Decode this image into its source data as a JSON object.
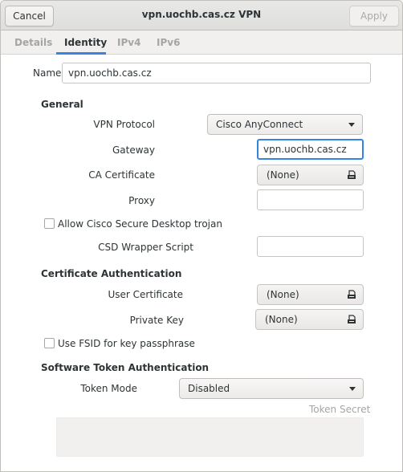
{
  "window": {
    "title": "vpn.uochb.cas.cz VPN",
    "cancel_label": "Cancel",
    "apply_label": "Apply"
  },
  "tabs": [
    {
      "label": "Details",
      "active": false
    },
    {
      "label": "Identity",
      "active": true
    },
    {
      "label": "IPv4",
      "active": false
    },
    {
      "label": "IPv6",
      "active": false
    }
  ],
  "name_row": {
    "label": "Name",
    "value": "vpn.uochb.cas.cz"
  },
  "general": {
    "heading": "General",
    "vpn_protocol": {
      "label": "VPN Protocol",
      "value": "Cisco AnyConnect"
    },
    "gateway": {
      "label": "Gateway",
      "value": "vpn.uochb.cas.cz"
    },
    "ca_certificate": {
      "label": "CA Certificate",
      "value": "(None)"
    },
    "proxy": {
      "label": "Proxy",
      "value": ""
    },
    "allow_csd": {
      "label": "Allow Cisco Secure Desktop trojan",
      "checked": false
    },
    "csd_wrapper": {
      "label": "CSD Wrapper Script",
      "value": ""
    }
  },
  "cert_auth": {
    "heading": "Certificate Authentication",
    "user_certificate": {
      "label": "User Certificate",
      "value": "(None)"
    },
    "private_key": {
      "label": "Private Key",
      "value": "(None)"
    },
    "use_fsid": {
      "label": "Use FSID for key passphrase",
      "checked": false
    }
  },
  "token_auth": {
    "heading": "Software Token Authentication",
    "token_mode": {
      "label": "Token Mode",
      "value": "Disabled"
    },
    "token_secret_label": "Token Secret"
  },
  "colors": {
    "accent": "#3584e4",
    "text": "#2e3436",
    "dim_text": "#a4a6a4"
  }
}
